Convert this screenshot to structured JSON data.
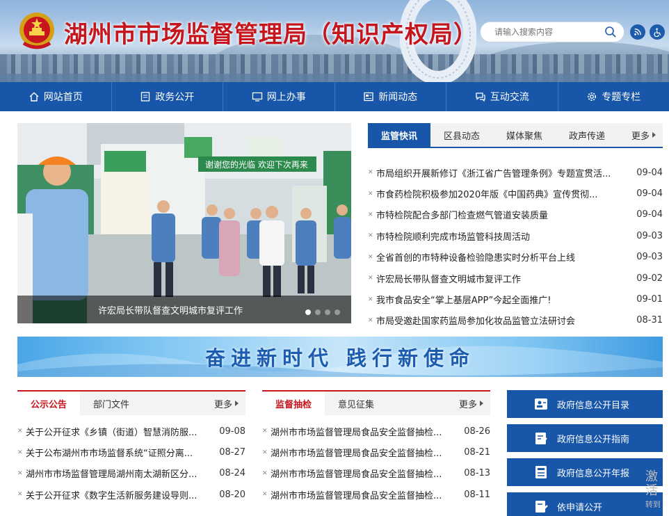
{
  "header": {
    "site_title": "湖州市市场监督管理局（知识产权局）",
    "search_placeholder": "请输入搜索内容"
  },
  "nav": {
    "items": [
      {
        "label": "网站首页",
        "icon": "home-icon"
      },
      {
        "label": "政务公开",
        "icon": "document-icon"
      },
      {
        "label": "网上办事",
        "icon": "monitor-icon"
      },
      {
        "label": "新闻动态",
        "icon": "newspaper-icon"
      },
      {
        "label": "互动交流",
        "icon": "chat-icon"
      },
      {
        "label": "专题专栏",
        "icon": "gear-icon"
      }
    ]
  },
  "slider": {
    "caption": "许宏局长带队督查文明城市复评工作",
    "dots": 4,
    "active_dot": 0,
    "scene_text": {
      "sign_welcome": "谢谢您的光临  欢迎下次再来"
    }
  },
  "news": {
    "tabs": [
      "监管快讯",
      "区县动态",
      "媒体聚焦",
      "政声传递"
    ],
    "more": "更多",
    "items": [
      {
        "title": "市局组织开展新修订《浙江省广告管理条例》专题宣贯活...",
        "date": "09-04"
      },
      {
        "title": "市食药检院积极参加2020年版《中国药典》宣传贯彻...",
        "date": "09-04"
      },
      {
        "title": "市特检院配合多部门检查燃气管道安装质量",
        "date": "09-04"
      },
      {
        "title": "市特检院顺利完成市场监管科技周活动",
        "date": "09-03"
      },
      {
        "title": "全省首创的市特种设备检验隐患实时分析平台上线",
        "date": "09-03"
      },
      {
        "title": "许宏局长带队督查文明城市复评工作",
        "date": "09-02"
      },
      {
        "title": "我市食品安全“掌上基层APP”今起全面推广!",
        "date": "09-01"
      },
      {
        "title": "市局受邀赴国家药监局参加化妆品监管立法研讨会",
        "date": "08-31"
      }
    ]
  },
  "slogan": "奋进新时代  践行新使命",
  "notices": {
    "tabs": [
      "公示公告",
      "部门文件"
    ],
    "more": "更多",
    "items": [
      {
        "title": "关于公开征求《乡镇（街道）智慧消防服...",
        "date": "09-08"
      },
      {
        "title": "关于公布湖州市市场监督系统“证照分离...",
        "date": "08-27"
      },
      {
        "title": "湖州市市场监督管理局湖州南太湖新区分...",
        "date": "08-24"
      },
      {
        "title": "关于公开征求《数字生活新服务建设导则...",
        "date": "08-20"
      }
    ]
  },
  "inspections": {
    "tabs": [
      "监督抽检",
      "意见征集"
    ],
    "more": "更多",
    "items": [
      {
        "title": "湖州市市场监督管理局食品安全监督抽检...",
        "date": "08-26"
      },
      {
        "title": "湖州市市场监督管理局食品安全监督抽检...",
        "date": "08-21"
      },
      {
        "title": "湖州市市场监督管理局食品安全监督抽检...",
        "date": "08-13"
      },
      {
        "title": "湖州市市场监督管理局食品安全监督抽检...",
        "date": "08-11"
      }
    ]
  },
  "side_buttons": [
    {
      "label": "政府信息公开目录",
      "icon": "catalog-icon"
    },
    {
      "label": "政府信息公开指南",
      "icon": "guide-icon"
    },
    {
      "label": "政府信息公开年报",
      "icon": "report-icon"
    },
    {
      "label": "依申请公开",
      "icon": "apply-icon"
    }
  ],
  "watermark": {
    "line1": "激活",
    "line2": "转到"
  },
  "colors": {
    "primary": "#1756a9",
    "accent_red": "#c8161e",
    "title_red": "#c4161c"
  }
}
